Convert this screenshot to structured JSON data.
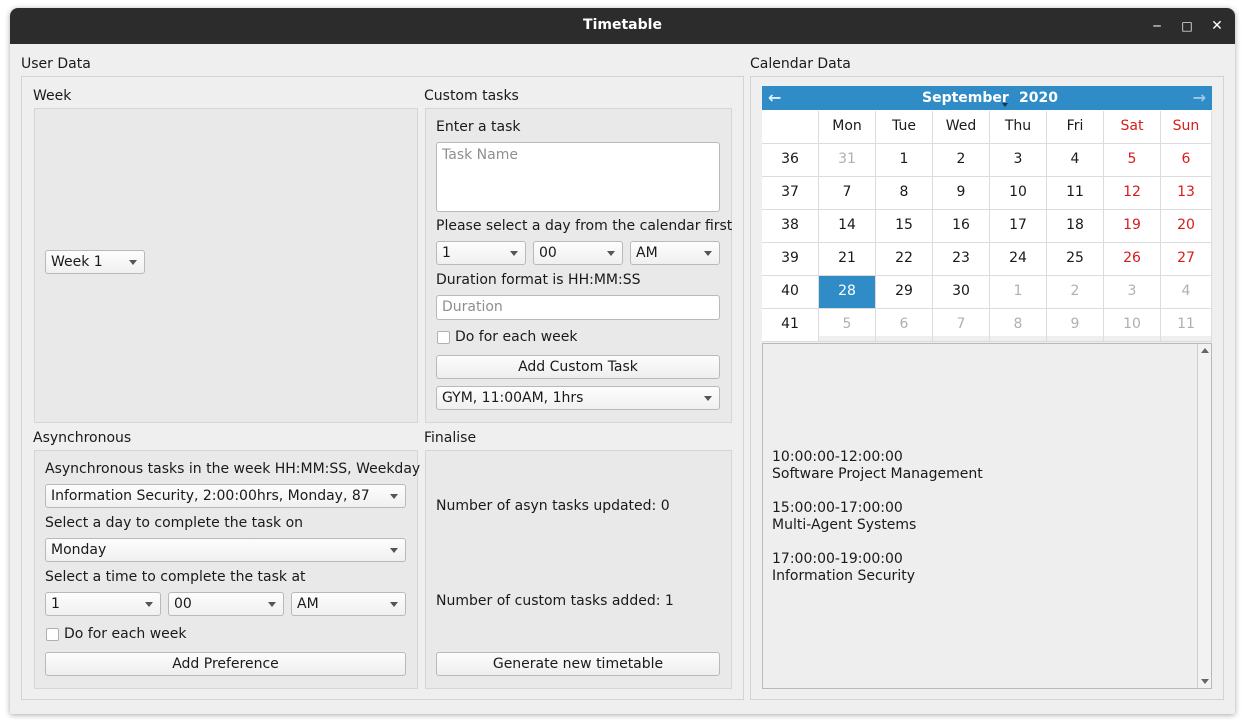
{
  "window": {
    "title": "Timetable"
  },
  "user_data": {
    "title": "User Data",
    "week": {
      "title": "Week",
      "selected": "Week 1"
    },
    "custom_tasks": {
      "title": "Custom tasks",
      "enter_label": "Enter a task",
      "task_placeholder": "Task Name",
      "select_day_label": "Please select a day from the calendar first",
      "hour": "1",
      "minute": "00",
      "ampm": "AM",
      "duration_label": "Duration format is HH:MM:SS",
      "duration_placeholder": "Duration",
      "each_week_label": "Do for each week",
      "add_button": "Add Custom Task",
      "tasks_selected": "GYM, 11:00AM, 1hrs"
    },
    "asynchronous": {
      "title": "Asynchronous",
      "tasks_label": "Asynchronous tasks in the week HH:MM:SS, Weekday",
      "tasks_selected": "Information Security, 2:00:00hrs, Monday, 87",
      "day_label": "Select a day to complete the task on",
      "day_selected": "Monday",
      "time_label": "Select a time to complete the task at",
      "hour": "1",
      "minute": "00",
      "ampm": "AM",
      "each_week_label": "Do for each week",
      "add_button": "Add Preference"
    },
    "finalise": {
      "title": "Finalise",
      "asyn_updated": "Number of asyn tasks updated: 0",
      "custom_added": "Number of custom tasks added: 1",
      "generate_button": "Generate new timetable"
    }
  },
  "calendar_data": {
    "title": "Calendar Data",
    "month": "September",
    "year": "2020",
    "headers": [
      "Mon",
      "Tue",
      "Wed",
      "Thu",
      "Fri",
      "Sat",
      "Sun"
    ],
    "weeks": [
      {
        "num": "36",
        "days": [
          "31",
          "1",
          "2",
          "3",
          "4",
          "5",
          "6"
        ]
      },
      {
        "num": "37",
        "days": [
          "7",
          "8",
          "9",
          "10",
          "11",
          "12",
          "13"
        ]
      },
      {
        "num": "38",
        "days": [
          "14",
          "15",
          "16",
          "17",
          "18",
          "19",
          "20"
        ]
      },
      {
        "num": "39",
        "days": [
          "21",
          "22",
          "23",
          "24",
          "25",
          "26",
          "27"
        ]
      },
      {
        "num": "40",
        "days": [
          "28",
          "29",
          "30",
          "1",
          "2",
          "3",
          "4"
        ]
      },
      {
        "num": "41",
        "days": [
          "5",
          "6",
          "7",
          "8",
          "9",
          "10",
          "11"
        ]
      }
    ],
    "schedule": [
      {
        "time": "10:00:00-12:00:00",
        "name": "Software Project Management"
      },
      {
        "time": "15:00:00-17:00:00",
        "name": "Multi-Agent Systems"
      },
      {
        "time": "17:00:00-19:00:00",
        "name": "Information Security"
      }
    ]
  },
  "colors": {
    "accent": "#308cc6",
    "weekend": "#d81b1b",
    "titlebar": "#2c2c2c"
  }
}
